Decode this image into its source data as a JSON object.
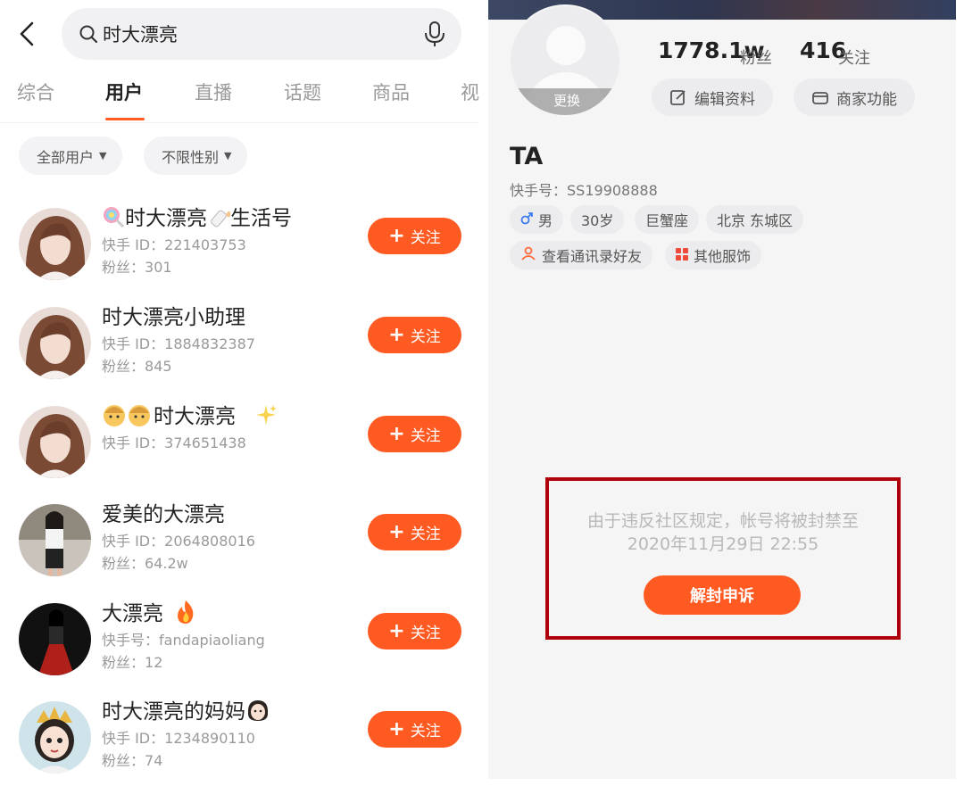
{
  "search": {
    "query": "时大漂亮"
  },
  "tabs": [
    {
      "label": "综合"
    },
    {
      "label": "用户"
    },
    {
      "label": "直播"
    },
    {
      "label": "话题"
    },
    {
      "label": "商品"
    },
    {
      "label": "视"
    }
  ],
  "active_tab": "用户",
  "filters": {
    "user_type": "全部用户",
    "gender": "不限性别"
  },
  "follow_label": "关注",
  "users": [
    {
      "name_prefix_emoji": "lollipop",
      "name": "时大漂亮",
      "name_suffix_emoji": "baby-bottle",
      "name_tail": "生活号",
      "id_label": "快手 ID：",
      "id": "221403753",
      "fans_label": "粉丝：",
      "fans": "301"
    },
    {
      "name": "时大漂亮小助理",
      "id_label": "快手 ID：",
      "id": "1884832387",
      "fans_label": "粉丝：",
      "fans": "845"
    },
    {
      "name_prefix_emoji": "baby-faces",
      "name": "时大漂亮",
      "name_suffix_emoji": "sparkles",
      "id_label": "快手 ID：",
      "id": "374651438"
    },
    {
      "name": "爱美的大漂亮",
      "id_label": "快手 ID：",
      "id": "2064808016",
      "fans_label": "粉丝：",
      "fans": "64.2w"
    },
    {
      "name": "大漂亮",
      "name_suffix_emoji": "fire",
      "id_label": "快手号：",
      "id": "fandapiaoliang",
      "fans_label": "粉丝：",
      "fans": "12"
    },
    {
      "name": "时大漂亮的妈妈",
      "name_suffix_emoji": "woman-face",
      "id_label": "快手 ID：",
      "id": "1234890110",
      "fans_label": "粉丝：",
      "fans": "74"
    }
  ],
  "profile": {
    "avatar_change_label": "更换",
    "fans_count": "1778.1w",
    "fans_label": "粉丝",
    "following_count": "416",
    "following_label": "关注",
    "edit_profile_label": "编辑资料",
    "merchant_label": "商家功能",
    "name": "TA",
    "kuaishou_id_label": "快手号：",
    "kuaishou_id": "SS19908888",
    "tags": [
      {
        "label": "男",
        "icon": "male-icon"
      },
      {
        "label": "30岁"
      },
      {
        "label": "巨蟹座"
      },
      {
        "label": "北京 东城区"
      }
    ],
    "actions": [
      {
        "label": "查看通讯录好友",
        "icon": "contacts-icon"
      },
      {
        "label": "其他服饰",
        "icon": "grid-icon"
      }
    ],
    "ban_notice_line1": "由于违反社区规定，帐号将被封禁至",
    "ban_notice_line2": "2020年11月29日 22:55",
    "appeal_label": "解封申诉"
  },
  "colors": {
    "accent": "#fe5a22",
    "highlight_border": "#b0000b",
    "muted_text": "#9a9a9a"
  }
}
